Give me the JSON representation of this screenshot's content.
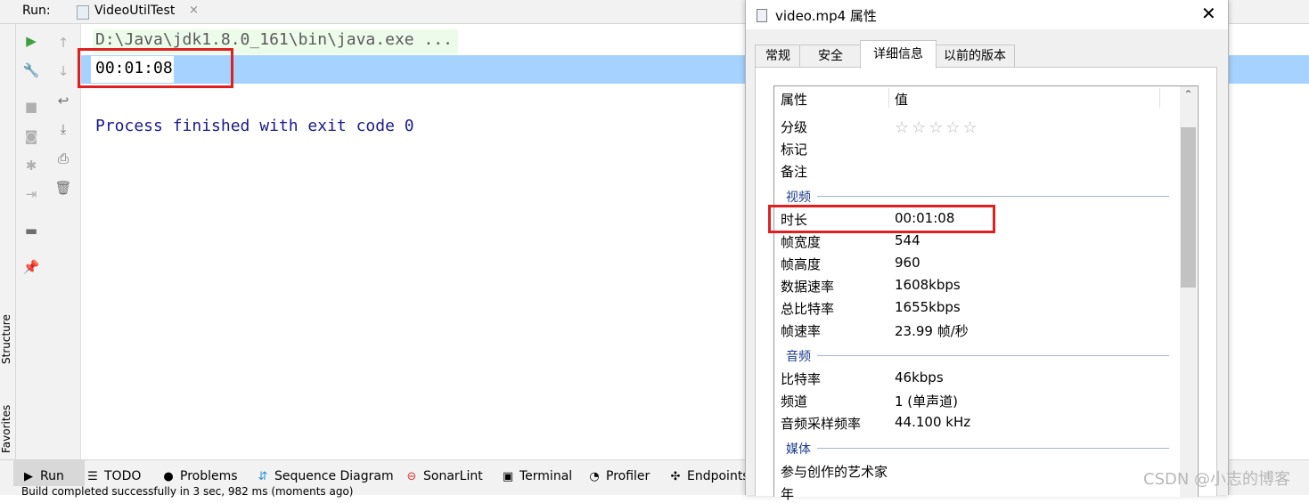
{
  "ide": {
    "run_label": "Run:",
    "run_tab": "VideoUtilTest",
    "close_glyph": "×",
    "console": {
      "command": "D:\\Java\\jdk1.8.0_161\\bin\\java.exe ...",
      "output": "00:01:08",
      "exit_message": "Process finished with exit code 0"
    },
    "side_labels": {
      "structure": "Structure",
      "favorites": "Favorites"
    },
    "bottom_tabs": [
      {
        "label": "Run",
        "icon": "run-icon"
      },
      {
        "label": "TODO",
        "icon": "todo-icon"
      },
      {
        "label": "Problems",
        "icon": "problems-icon"
      },
      {
        "label": "Sequence Diagram",
        "icon": "sequence-diagram-icon"
      },
      {
        "label": "SonarLint",
        "icon": "sonarlint-icon"
      },
      {
        "label": "Terminal",
        "icon": "terminal-icon"
      },
      {
        "label": "Profiler",
        "icon": "profiler-icon"
      },
      {
        "label": "Endpoints",
        "icon": "endpoints-icon"
      }
    ],
    "status": "Build completed successfully in 3 sec, 982 ms (moments ago)"
  },
  "dialog": {
    "title": "video.mp4 属性",
    "close_glyph": "✕",
    "tabs": [
      "常规",
      "安全",
      "详细信息",
      "以前的版本"
    ],
    "active_tab": "详细信息",
    "columns": {
      "name": "属性",
      "value": "值"
    },
    "rating_stars": "☆☆☆☆☆",
    "rows": {
      "rating": "分级",
      "tags": "标记",
      "comments": "备注",
      "video_group": "视频",
      "length": {
        "label": "时长",
        "value": "00:01:08"
      },
      "frame_width": {
        "label": "帧宽度",
        "value": "544"
      },
      "frame_height": {
        "label": "帧高度",
        "value": "960"
      },
      "data_rate": {
        "label": "数据速率",
        "value": "1608kbps"
      },
      "total_bitrate": {
        "label": "总比特率",
        "value": "1655kbps"
      },
      "frame_rate": {
        "label": "帧速率",
        "value": "23.99 帧/秒"
      },
      "audio_group": "音频",
      "bit_rate": {
        "label": "比特率",
        "value": "46kbps"
      },
      "channels": {
        "label": "频道",
        "value": "1 (单声道)"
      },
      "sample_rate": {
        "label": "音频采样频率",
        "value": "44.100 kHz"
      },
      "media_group": "媒体",
      "contributing_artists": "参与创作的艺术家",
      "year": "年"
    }
  },
  "watermark": "CSDN @小志的博客",
  "colors": {
    "highlight_box": "#e02020",
    "selection": "#a6d2ff",
    "exit_text": "#1a1a8c"
  }
}
